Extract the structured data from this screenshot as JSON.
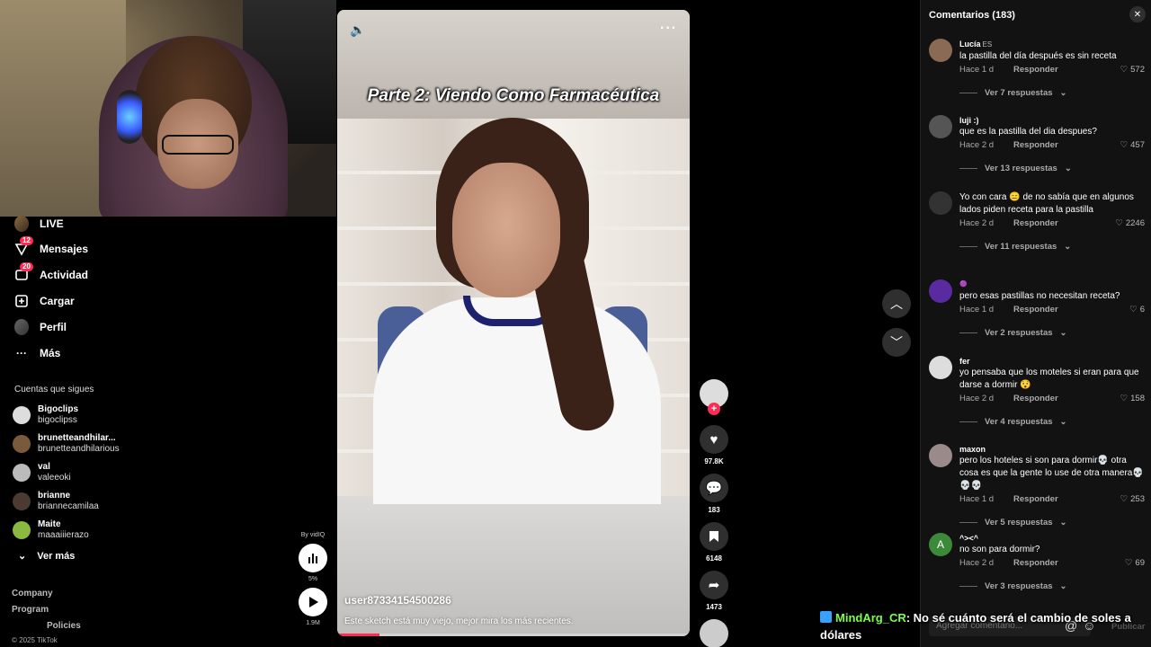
{
  "sidebar": {
    "nav": [
      {
        "label": "LIVE",
        "icon": "live-avatar-icon"
      },
      {
        "label": "Mensajes",
        "icon": "send-icon",
        "badge": "12"
      },
      {
        "label": "Actividad",
        "icon": "inbox-icon",
        "badge": "20"
      },
      {
        "label": "Cargar",
        "icon": "upload-icon"
      },
      {
        "label": "Perfil",
        "icon": "profile-avatar-icon"
      },
      {
        "label": "Más",
        "icon": "more-dots-icon"
      }
    ],
    "following_title": "Cuentas que sigues",
    "following": [
      {
        "name": "Bigoclips",
        "handle": "bigoclipss"
      },
      {
        "name": "brunetteandhilar...",
        "handle": "brunetteandhilarious"
      },
      {
        "name": "val",
        "handle": "valeeoki"
      },
      {
        "name": "brianne",
        "handle": "briannecamilaa"
      },
      {
        "name": "Maite",
        "handle": "maaaiiierazo"
      }
    ],
    "see_more": "Ver más",
    "footer": [
      "Company",
      "Program",
      "Policies"
    ],
    "copyright": "© 2025 TikTok"
  },
  "vidiq": {
    "by": "By vidIQ",
    "percent": "5%",
    "views": "1.9M"
  },
  "video": {
    "title": "Parte 2: Viendo Como Farmacéutica",
    "username": "user87334154500286",
    "caption": "Este sketch está muy viejo, mejor mira los más recientes.",
    "progress": 0.12
  },
  "actions": {
    "likes": "97.8K",
    "comments": "183",
    "saves": "6148",
    "shares": "1473"
  },
  "comments": {
    "header": "Comentarios (183)",
    "reply_label": "Responder",
    "items": [
      {
        "user": "Lucía",
        "lang": "ES",
        "text": "la pastilla del día después es sin receta",
        "time": "Hace 1 d",
        "likes": "572",
        "replies": "Ver 7 respuestas",
        "avatar_color": "#8a6a55"
      },
      {
        "user": "luji :)",
        "lang": "",
        "text": "que es la pastilla del dia despues?",
        "time": "Hace 2 d",
        "likes": "457",
        "replies": "Ver 13 respuestas",
        "avatar_color": "#555555"
      },
      {
        "user": "",
        "lang": "",
        "text": "Yo con cara 😑 de no sabía que en algunos lados piden receta para la pastilla",
        "time": "Hace 2 d",
        "likes": "2246",
        "replies": "Ver 11 respuestas",
        "avatar_color": "#333333"
      },
      {
        "user": "🟣",
        "lang": "",
        "text": "pero esas pastillas no necesitan receta?",
        "time": "Hace 1 d",
        "likes": "6",
        "replies": "Ver 2 respuestas",
        "avatar_color": "#5a2aa0"
      },
      {
        "user": "fer",
        "lang": "",
        "text": "yo pensaba que los moteles si eran para que darse a dormir 😯",
        "time": "Hace 2 d",
        "likes": "158",
        "replies": "Ver 4 respuestas",
        "avatar_color": "#dddddd"
      },
      {
        "user": "maxon",
        "lang": "",
        "text": "pero los hoteles si son para dormir💀 otra cosa es que la gente lo use de otra manera💀💀💀",
        "time": "Hace 1 d",
        "likes": "253",
        "replies": "Ver 5 respuestas",
        "avatar_color": "#9a8a8a"
      },
      {
        "user": "^><^",
        "lang": "",
        "text": "no son para dormir?",
        "time": "Hace 2 d",
        "likes": "69",
        "replies": "Ver 3 respuestas",
        "avatar_color": "#3a8a3a",
        "initial": "A"
      }
    ],
    "input_placeholder": "Agregar comentario...",
    "publish": "Publicar"
  },
  "chat": {
    "user": "MindArg_CR",
    "message": ": No sé cuánto será el cambio de soles a dólares"
  }
}
